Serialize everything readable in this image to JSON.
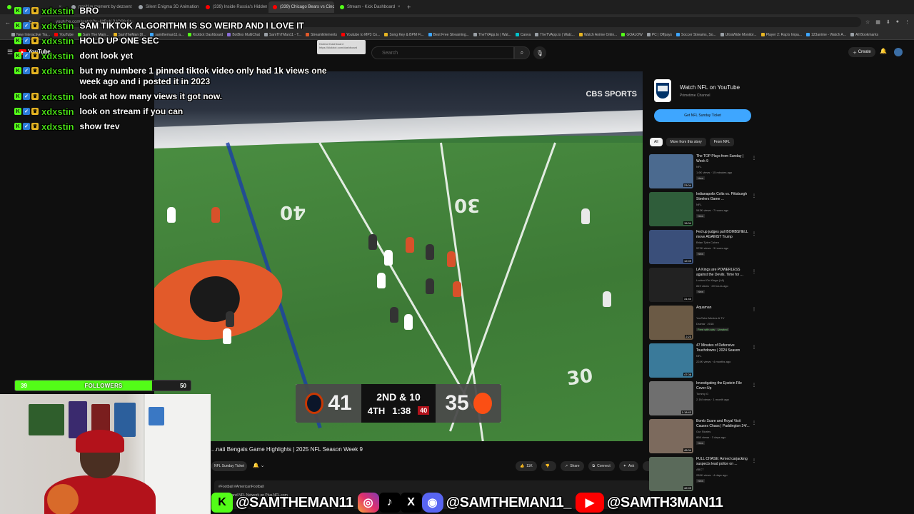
{
  "browser": {
    "tabs": [
      {
        "label": "...",
        "color": "#53fc18"
      },
      {
        "label": "positive moment by dezsent",
        "color": "#9aa0a6"
      },
      {
        "label": "Silent Enigma 3D Animation Ch",
        "color": "#9aa0a6"
      },
      {
        "label": "(339) Inside Russia's Hidden W",
        "color": "#ff0000"
      },
      {
        "label": "(339) Chicago Bears vs Cincinn",
        "color": "#ff0000",
        "active": true
      },
      {
        "label": "Stream - Kick Dashboard",
        "color": "#53fc18"
      }
    ],
    "new_tab": "+",
    "url": "youtube.com/watch?v=HtBuKJUQSfc&t=",
    "bookmarks": [
      "New Interactive Tra...",
      "YouTube",
      "Sam The Main...",
      "SamTheMan Dl...",
      "samtheman11 a...",
      "Kickbot Dashboard",
      "BotBox MultiChat",
      "SamThTMan11 - T...",
      "StreamElements",
      "Youtube to MP3 Co...",
      "Song Key & BPM Fi...",
      "Best Free Streaming...",
      "TheTVApp.to | Wat...",
      "Canva",
      "TheTVApp.to | Watc...",
      "Watch Anime Onlin...",
      "GOALOW",
      "PC | Offpays",
      "Soccer Streams, So...",
      "UltraWide Monitor...",
      "Player 2: Rap's Impa...",
      "123anime - Watch A...",
      "All Bookmarks"
    ],
    "tooltip": "Kickbot Dashboard https://kickbot.com/dashboard"
  },
  "youtube": {
    "logo": "YouTube",
    "search_placeholder": "Search",
    "create_label": "Create",
    "video_title": "...nati Bengals Game Highlights | 2025 NFL Season Week 9",
    "channel_button": "NFL Sunday Ticket",
    "actions": [
      {
        "icon": "like-icon",
        "label": "11K"
      },
      {
        "icon": "dislike-icon",
        "label": ""
      },
      {
        "icon": "share-icon",
        "label": "Share"
      },
      {
        "icon": "connect-icon",
        "label": "Connect"
      },
      {
        "icon": "ask-icon",
        "label": "Ask"
      },
      {
        "icon": "more-icon",
        "label": "..."
      }
    ],
    "description": "#Football #AmericanFootball",
    "description2": "...Zone, and NFL Network on Plus.NFL.com"
  },
  "scorebug": {
    "away_score": "41",
    "home_score": "35",
    "down": "2ND & 10",
    "quarter": "4TH",
    "clock": "1:38",
    "play_clock": "40",
    "away_color": "#0b162a",
    "home_color": "#fb4f14"
  },
  "broadcast": {
    "network": "CBS SPORTS",
    "yard_numbers": [
      "40",
      "30",
      "30"
    ]
  },
  "sidebar": {
    "ad": {
      "title": "Watch NFL on YouTube",
      "subtitle": "Primetime Channel",
      "button": "Get NFL Sunday Ticket"
    },
    "chips": [
      "All",
      "More from this story",
      "From NFL"
    ],
    "recommendations": [
      {
        "title": "The TOP Plays from Sunday | Week 9",
        "channel": "NFL",
        "meta": "1.6K views · 15 minutes ago",
        "badge": "New",
        "duration": "23:04",
        "thumb": "#4b6a8f"
      },
      {
        "title": "Indianapolis Colts vs. Pittsburgh Steelers Game ...",
        "channel": "NFL",
        "meta": "543K views · 7 hours ago",
        "badge": "New",
        "duration": "15:04",
        "thumb": "#2f5d3a"
      },
      {
        "title": "Fed up judges pull BOMBSHELL move AGAINST Trump",
        "channel": "Brian Tyler Cohen",
        "meta": "572K views · 3 hours ago",
        "badge": "New",
        "duration": "12:09",
        "thumb": "#3a4f7a"
      },
      {
        "title": "LA Kings are POWERLESS against the Devils. Time for ...",
        "channel": "Locked On Kings (LA)",
        "meta": "819 views · 20 hours ago",
        "badge": "New",
        "duration": "31:43",
        "thumb": "#222222"
      },
      {
        "title": "Aquaman",
        "channel": "YouTube Movies & TV",
        "meta": "Drama · 2018",
        "badge": "Free with ads · Unrated",
        "badge_green": true,
        "duration": "2:23",
        "thumb": "#6b5a45"
      },
      {
        "title": "47 Minutes of Defensive Touchdowns | 2024 Season",
        "channel": "NFL",
        "meta": "224K views · 4 months ago",
        "badge": "",
        "duration": "47:08",
        "thumb": "#3a7a9a"
      },
      {
        "title": "Investigating the Epstein File Cover-Up",
        "channel": "Tommy G",
        "meta": "2.1M views · 1 month ago",
        "badge": "",
        "duration": "1:18:43",
        "thumb": "#6f6f6f"
      },
      {
        "title": "Bomb Scare and Royal Visit Causes Chaos | Paddington 24/...",
        "channel": "Our Stories",
        "meta": "86K views · 3 days ago",
        "badge": "New",
        "duration": "45:04",
        "thumb": "#7c6a5d"
      },
      {
        "title": "FULL CHASE: Armed carjacking suspects lead police on ...",
        "channel": "ABC7",
        "meta": "289K views · 4 days ago",
        "badge": "New",
        "duration": "42:09",
        "thumb": "#5a6a5a"
      }
    ]
  },
  "overlay": {
    "chat": [
      {
        "user": "xdxstin",
        "text": "BRO"
      },
      {
        "user": "xdxstin",
        "text": "SAM TIKTOK ALGORITHM IS SO WEIRD AND I LOVE IT"
      },
      {
        "user": "xdxstin",
        "text": "HOLD UP ONE SEC"
      },
      {
        "user": "xdxstin",
        "text": "dont look yet"
      },
      {
        "user": "xdxstin",
        "text": "but my numbere 1 pinned tiktok video only had 1k views one week ago and i posted it in 2023"
      },
      {
        "user": "xdxstin",
        "text": "look at how many views it got now."
      },
      {
        "user": "xdxstin",
        "text": "look on stream if you can"
      },
      {
        "user": "xdxstin",
        "text": "show trev"
      }
    ],
    "followers": {
      "current": "39",
      "label": "FOLLOWERS",
      "goal": "50",
      "fraction": 0.78
    },
    "socials": [
      {
        "icon": "kick-icon",
        "glyph": "K",
        "cls": "ic-kick",
        "handle": "@SAMTHEMAN11"
      },
      {
        "icon": "instagram-icon",
        "glyph": "◎",
        "cls": "ic-ig",
        "handle": ""
      },
      {
        "icon": "tiktok-icon",
        "glyph": "♪",
        "cls": "ic-tt",
        "handle": ""
      },
      {
        "icon": "x-icon",
        "glyph": "X",
        "cls": "ic-x",
        "handle": ""
      },
      {
        "icon": "discord-icon",
        "glyph": "◉",
        "cls": "ic-dc",
        "handle": "@SAMTHEMAN11_"
      },
      {
        "icon": "youtube-icon",
        "glyph": "▶",
        "cls": "ic-yt",
        "handle": "@SAMTH3MAN11"
      }
    ]
  }
}
